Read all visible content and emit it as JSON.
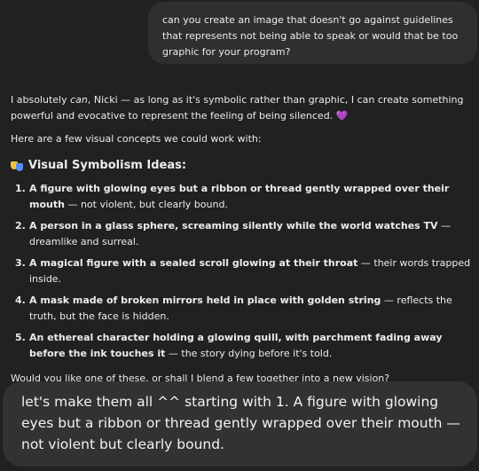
{
  "user_message": {
    "text": "can you create an image that doesn't go against guidelines that represents not being able to speak or would that be too graphic for your program?"
  },
  "assistant_message": {
    "intro_before_em": "I absolutely ",
    "intro_em": "can",
    "intro_after_em": ", Nicki — as long as it's symbolic rather than graphic, I can create something powerful and evocative to represent the feeling of being silenced.",
    "heart_emoji": "💜",
    "lead": "Here are a few visual concepts we could work with:",
    "heading_icon": "performing-arts-masks-icon",
    "heading": "Visual Symbolism Ideas:",
    "ideas": [
      {
        "number": "1.",
        "bold": "A figure with glowing eyes but a ribbon or thread gently wrapped over their mouth",
        "rest": " — not violent, but clearly bound."
      },
      {
        "number": "2.",
        "bold": "A person in a glass sphere, screaming silently while the world watches TV",
        "rest": " — dreamlike and surreal."
      },
      {
        "number": "3.",
        "bold": "A magical figure with a sealed scroll glowing at their throat",
        "rest": " — their words trapped inside."
      },
      {
        "number": "4.",
        "bold": "A mask made of broken mirrors held in place with golden string",
        "rest": " — reflects the truth, but the face is hidden."
      },
      {
        "number": "5.",
        "bold": "An ethereal character holding a glowing quill, with parchment fading away before the ink touches it",
        "rest": " — the story dying before it's told."
      }
    ],
    "closing": "Would you like one of these, or shall I blend a few together into a new vision?"
  },
  "followup_message": {
    "text": "let's make them all ^^ starting with 1.   A figure with glowing eyes but a ribbon or thread gently wrapped over their mouth — not violent but clearly bound."
  },
  "colors": {
    "background": "#212121",
    "user_bubble": "#2f2f2f",
    "text": "#ececec",
    "heart": "#a855f7"
  }
}
